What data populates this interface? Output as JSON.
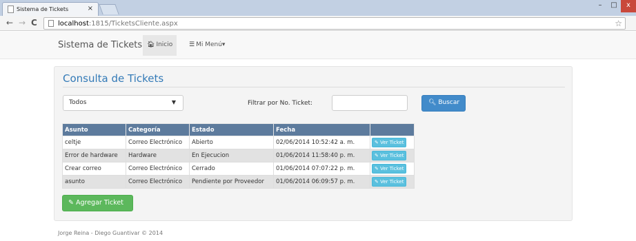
{
  "browser": {
    "tab_title": "Sistema de Tickets",
    "tab_close": "×",
    "url_host": "localhost",
    "url_path": ":1815/TicketsCliente.aspx",
    "window_min": "–",
    "window_max": "□",
    "window_close": "x"
  },
  "navbar": {
    "brand": "Sistema de Tickets",
    "inicio_label": "Inicio",
    "menu_label": "Mi Menú",
    "menu_caret": "▾"
  },
  "panel": {
    "title": "Consulta de Tickets",
    "select_value": "Todos",
    "filter_label": "Filtrar por No. Ticket:",
    "filter_value": "",
    "search_button": "Buscar",
    "add_button": "Agregar Ticket"
  },
  "table": {
    "headers": [
      "Asunto",
      "Categoría",
      "Estado",
      "Fecha",
      ""
    ],
    "rows": [
      {
        "asunto": "celtje",
        "categoria": "Correo Electrónico",
        "estado": "Abierto",
        "fecha": "02/06/2014 10:52:42 a. m.",
        "action": "Ver Ticket"
      },
      {
        "asunto": "Error de hardware",
        "categoria": "Hardware",
        "estado": "En Ejecucion",
        "fecha": "01/06/2014 11:58:40 p. m.",
        "action": "Ver Ticket"
      },
      {
        "asunto": "Crear correo",
        "categoria": "Correo Electrónico",
        "estado": "Cerrado",
        "fecha": "01/06/2014 07:07:22 p. m.",
        "action": "Ver Ticket"
      },
      {
        "asunto": "asunto",
        "categoria": "Correo Electrónico",
        "estado": "Pendiente por Proveedor",
        "fecha": "01/06/2014 06:09:57 p. m.",
        "action": "Ver Ticket"
      }
    ]
  },
  "footer": {
    "text": "Jorge Reina - Diego Guantivar © 2014"
  },
  "colors": {
    "primary": "#428bca",
    "success": "#5cb85c",
    "info": "#5bc0de",
    "grid_header": "#5d7b9d",
    "title": "#337ab7"
  },
  "icons": {
    "inicio": "home-icon",
    "menu": "list-icon",
    "search": "search-icon",
    "add": "pencil-icon",
    "ver": "edit-icon"
  }
}
